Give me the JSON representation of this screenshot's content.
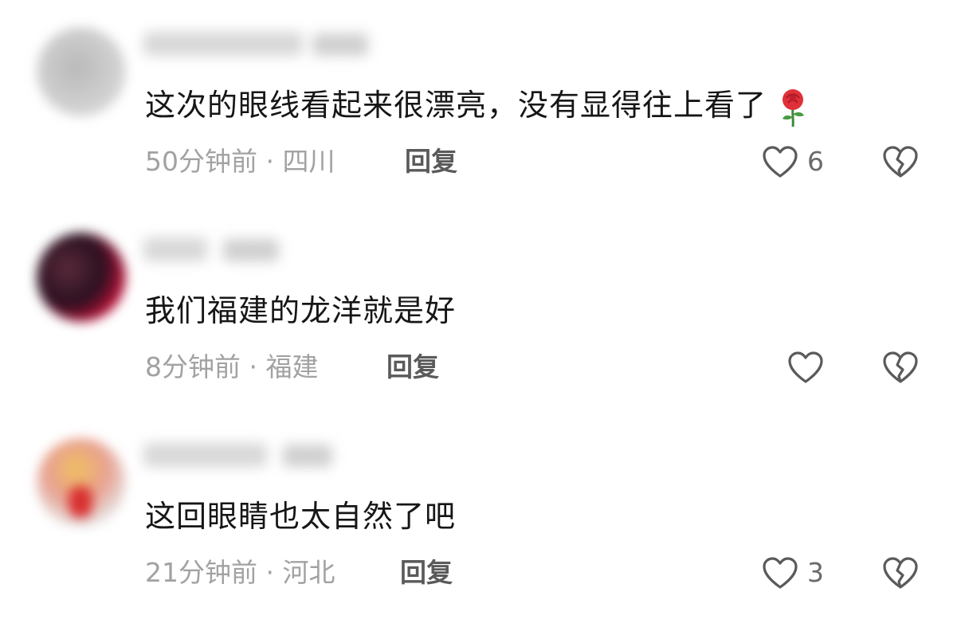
{
  "comments": [
    {
      "text": "这次的眼线看起来很漂亮，没有显得往上看了",
      "emoji": "rose",
      "time": "50分钟前",
      "location": "四川",
      "reply_label": "回复",
      "like_count": "6"
    },
    {
      "text": "我们福建的龙洋就是好",
      "time": "8分钟前",
      "location": "福建",
      "reply_label": "回复",
      "like_count": ""
    },
    {
      "text": "这回眼睛也太自然了吧",
      "time": "21分钟前",
      "location": "河北",
      "reply_label": "回复",
      "like_count": "3"
    }
  ],
  "separator": " · ",
  "colors": {
    "text": "#161616",
    "meta": "#a2a2a2",
    "reply": "#5a5a5a",
    "icon": "#5a5a5a",
    "rose": "#e0303a",
    "stem": "#3d8a3a"
  },
  "icons": {
    "like": "heart-outline-icon",
    "dislike": "broken-heart-icon",
    "emoji": "rose-emoji-icon"
  }
}
